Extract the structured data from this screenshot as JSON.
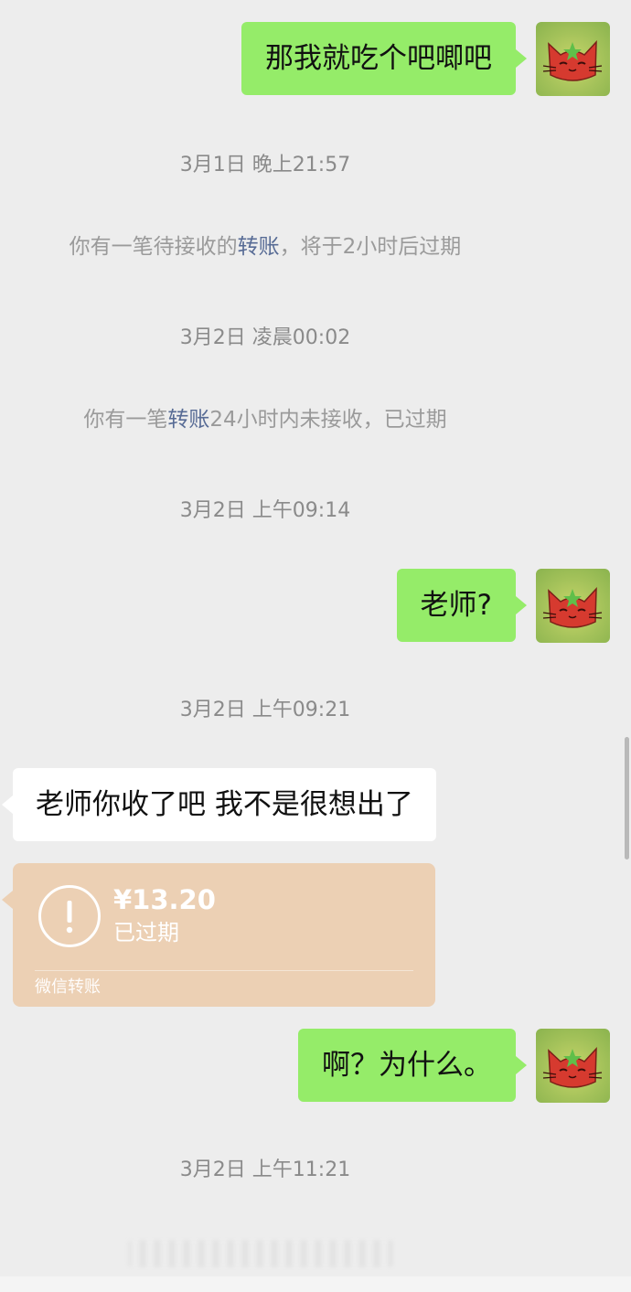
{
  "messages": {
    "msg1": "那我就吃个吧唧吧",
    "ts1": "3月1日 晚上21:57",
    "sys1": {
      "pre": "你有一笔待接收的",
      "link": "转账",
      "post": "，将于2小时后过期"
    },
    "ts2": "3月2日 凌晨00:02",
    "sys2": {
      "pre": "你有一笔",
      "link": "转账",
      "post": "24小时内未接收，已过期"
    },
    "ts3": "3月2日 上午09:14",
    "msg2": "老师?",
    "ts4": "3月2日 上午09:21",
    "msg3": "老师你收了吧 我不是很想出了",
    "transfer": {
      "amount": "¥13.20",
      "status": "已过期",
      "footer": "微信转账",
      "icon": "exclamation-circle-icon"
    },
    "msg4": "啊？为什么。",
    "ts5": "3月2日 上午11:21"
  },
  "colors": {
    "background": "#ededed",
    "outgoing_bubble": "#95ec69",
    "incoming_bubble": "#ffffff",
    "transfer_card": "#ecd0b4",
    "link": "#576b95"
  },
  "avatar": {
    "icon": "red-cat-avatar-icon"
  }
}
